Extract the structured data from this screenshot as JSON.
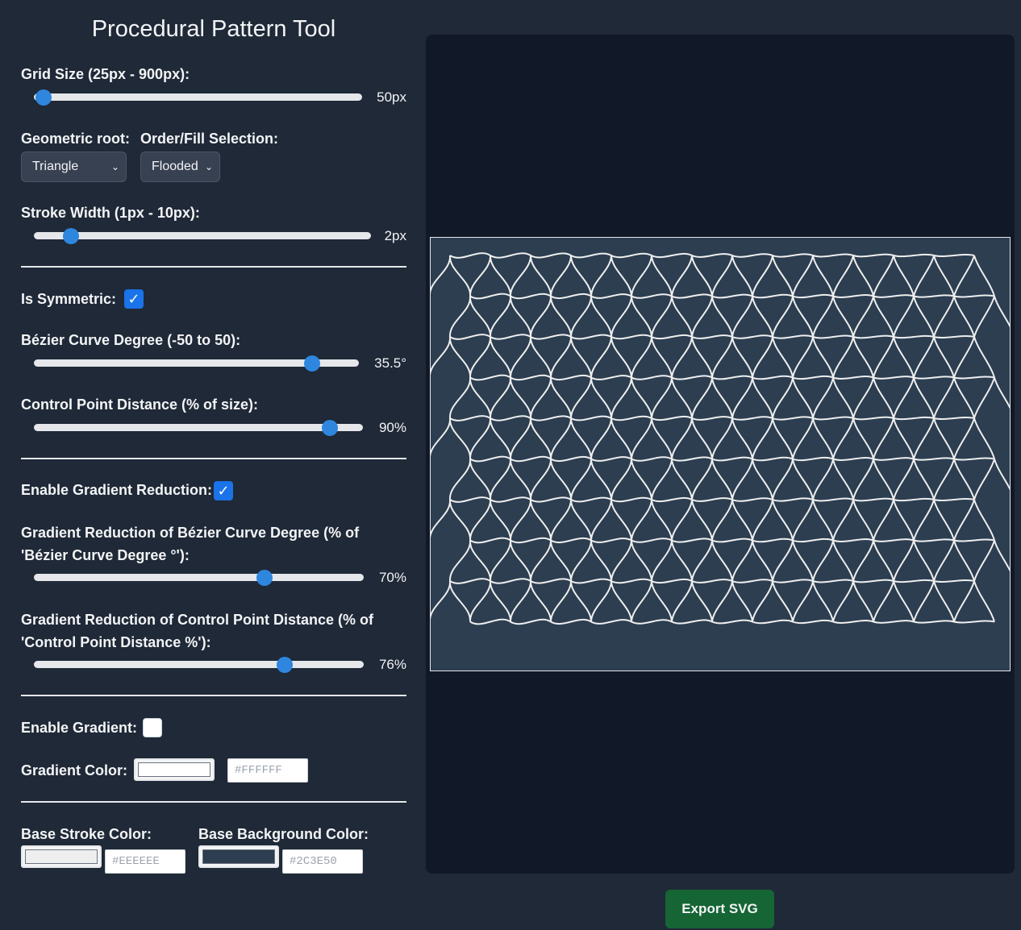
{
  "app": {
    "title": "Procedural Pattern Tool"
  },
  "controls": {
    "grid_size": {
      "label": "Grid Size (25px - 900px):",
      "value": 50,
      "min": 25,
      "max": 900,
      "display": "50px"
    },
    "geometric_root": {
      "label": "Geometric root:",
      "selected": "Triangle"
    },
    "order_fill": {
      "label": "Order/Fill Selection:",
      "selected": "Flooded"
    },
    "stroke_width": {
      "label": "Stroke Width (1px - 10px):",
      "value": 2,
      "min": 1,
      "max": 10,
      "display": "2px"
    },
    "is_symmetric": {
      "label": "Is Symmetric:",
      "checked": true
    },
    "bezier_degree": {
      "label": "Bézier Curve Degree (-50 to 50):",
      "value": 35.5,
      "min": -50,
      "max": 50,
      "display": "35.5°"
    },
    "control_point_distance": {
      "label": "Control Point Distance (% of size):",
      "value": 90,
      "min": 0,
      "max": 100,
      "display": "90%"
    },
    "enable_gradient_reduction": {
      "label": "Enable Gradient Reduction:",
      "checked": true
    },
    "gradient_reduction_bezier": {
      "label": "Gradient Reduction of Bézier Curve Degree (% of 'Bézier Curve Degree °'):",
      "value": 70,
      "min": 0,
      "max": 100,
      "display": "70%"
    },
    "gradient_reduction_cpd": {
      "label": "Gradient Reduction of Control Point Distance (% of 'Control Point Distance %'):",
      "value": 76,
      "min": 0,
      "max": 100,
      "display": "76%"
    },
    "enable_gradient": {
      "label": "Enable Gradient:",
      "checked": false
    },
    "gradient_color": {
      "label": "Gradient Color:",
      "color": "#FFFFFF",
      "hex_text": "#FFFFFF"
    },
    "base_stroke_color": {
      "label": "Base Stroke Color:",
      "color": "#EEEEEE",
      "hex_text": "#EEEEEE"
    },
    "base_background_color": {
      "label": "Base Background Color:",
      "color": "#2C3E50",
      "hex_text": "#2C3E50"
    }
  },
  "export": {
    "label": "Export SVG"
  },
  "colors": {
    "accent": "#2F86DE",
    "checkbox": "#1A73E8",
    "export_button": "#166534",
    "stage": "#111827",
    "panel": "#1F2937"
  }
}
